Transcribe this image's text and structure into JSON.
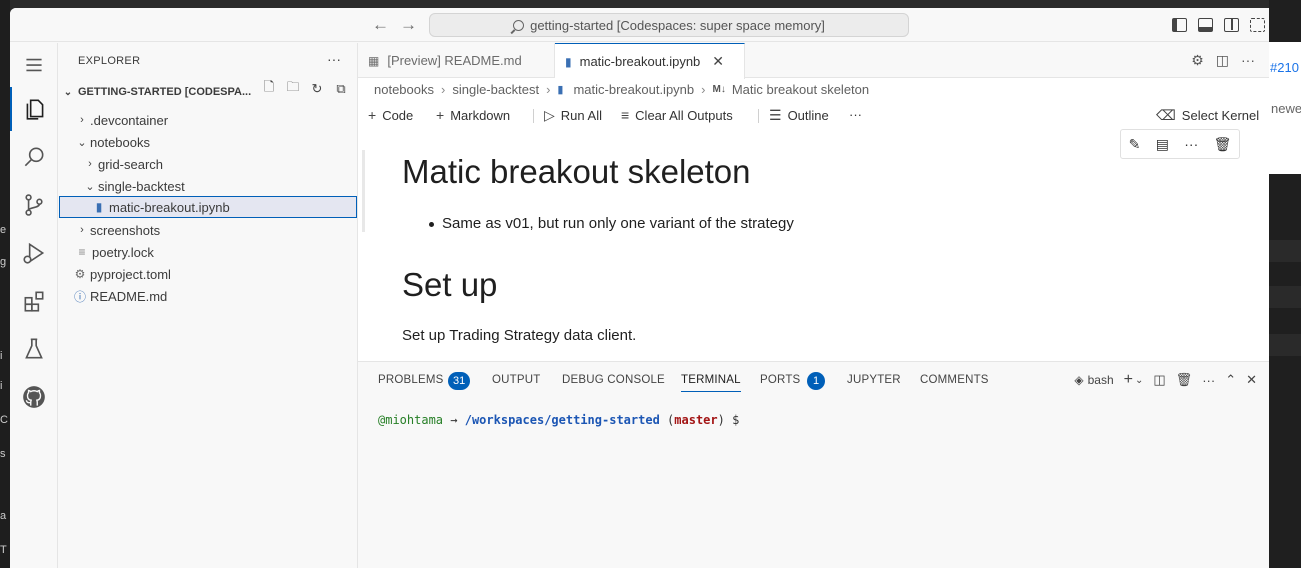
{
  "titlebar": {
    "back_icon": "arrow-left-icon",
    "forward_icon": "arrow-right-icon",
    "command_center": "getting-started [Codespaces: super space memory]"
  },
  "activity_bar": {
    "items": [
      "menu",
      "explorer",
      "search",
      "source-control",
      "run-debug",
      "extensions",
      "testing",
      "github"
    ]
  },
  "sidebar": {
    "title": "EXPLORER",
    "workspace": "GETTING-STARTED [CODESPA...",
    "tree": [
      {
        "label": ".devcontainer",
        "type": "folder",
        "expanded": false
      },
      {
        "label": "notebooks",
        "type": "folder",
        "expanded": true
      },
      {
        "label": "grid-search",
        "type": "folder",
        "expanded": false
      },
      {
        "label": "single-backtest",
        "type": "folder",
        "expanded": true
      },
      {
        "label": "matic-breakout.ipynb",
        "type": "notebook",
        "selected": true
      },
      {
        "label": "screenshots",
        "type": "folder",
        "expanded": false
      },
      {
        "label": "poetry.lock",
        "type": "file"
      },
      {
        "label": "pyproject.toml",
        "type": "settings-file"
      },
      {
        "label": "README.md",
        "type": "info-file"
      }
    ]
  },
  "tabs": [
    {
      "label": "[Preview] README.md",
      "active": false
    },
    {
      "label": "matic-breakout.ipynb",
      "active": true
    }
  ],
  "breadcrumb": {
    "folder1": "notebooks",
    "folder2": "single-backtest",
    "file": "matic-breakout.ipynb",
    "symbol_prefix": "M↓",
    "symbol": "Matic breakout skeleton"
  },
  "notebook_toolbar": {
    "code": "Code",
    "markdown": "Markdown",
    "run_all": "Run All",
    "clear_outputs": "Clear All Outputs",
    "outline": "Outline",
    "more": "···",
    "select_kernel": "Select Kernel"
  },
  "notebook": {
    "h1": "Matic breakout skeleton",
    "bullet": "Same as v01, but run only one variant of the strategy",
    "h1b": "Set up",
    "paragraph": "Set up Trading Strategy data client."
  },
  "panel": {
    "tabs": {
      "problems": "PROBLEMS",
      "problems_count": "31",
      "output": "OUTPUT",
      "debug_console": "DEBUG CONSOLE",
      "terminal": "TERMINAL",
      "ports": "PORTS",
      "ports_count": "1",
      "jupyter": "JUPYTER",
      "comments": "COMMENTS"
    },
    "shell": "bash",
    "terminal": {
      "user": "@miohtama",
      "arrow": "→",
      "path": "/workspaces/getting-started",
      "branch_open": "(",
      "branch": "master",
      "branch_close": ")",
      "prompt": "$"
    }
  },
  "background": {
    "right_ref": "#210",
    "right_new": "newe",
    "left_chars": [
      "e",
      "g",
      "i",
      "i",
      "C",
      "s",
      "a",
      "T"
    ]
  },
  "colors": {
    "accent": "#005fb8",
    "selection_bg": "#e4e6f1",
    "terminal_user": "#267f26",
    "terminal_path": "#1c56b4",
    "terminal_branch": "#a31515"
  }
}
